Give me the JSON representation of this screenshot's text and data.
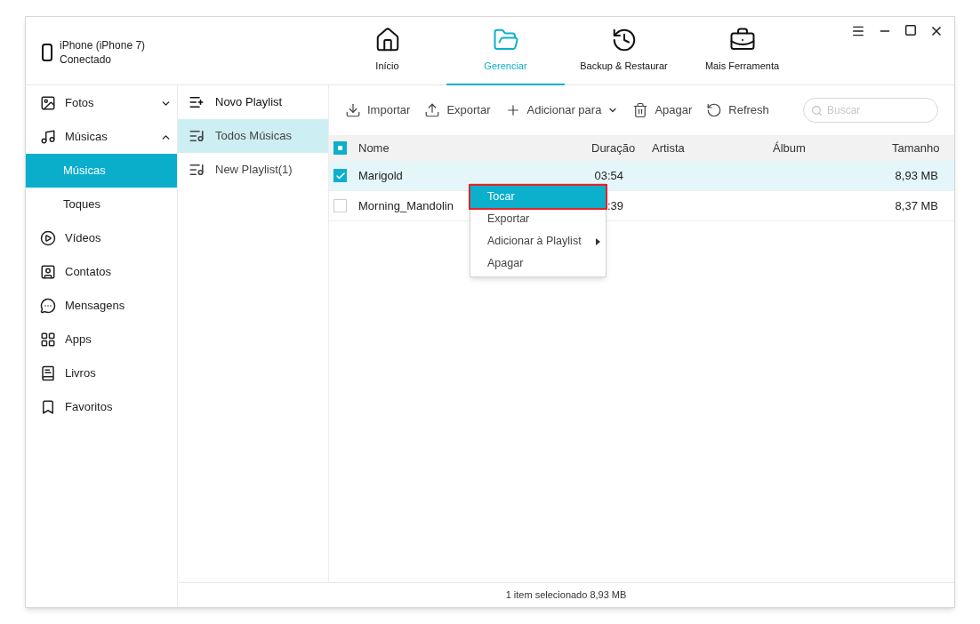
{
  "device": {
    "name": "iPhone (iPhone 7)",
    "status": "Conectado"
  },
  "nav": [
    {
      "label": "Início",
      "selected": false
    },
    {
      "label": "Gerenciar",
      "selected": true
    },
    {
      "label": "Backup & Restaurar",
      "selected": false
    },
    {
      "label": "Mais Ferramenta",
      "selected": false
    }
  ],
  "sidebar": {
    "items": [
      {
        "label": "Fotos",
        "expanded": false,
        "selected": false
      },
      {
        "label": "Músicas",
        "expanded": true,
        "selected": false,
        "children": [
          {
            "label": "Músicas",
            "selected": true
          },
          {
            "label": "Toques",
            "selected": false
          }
        ]
      },
      {
        "label": "Vídeos",
        "selected": false
      },
      {
        "label": "Contatos",
        "selected": false
      },
      {
        "label": "Mensagens",
        "selected": false
      },
      {
        "label": "Apps",
        "selected": false
      },
      {
        "label": "Livros",
        "selected": false
      },
      {
        "label": "Favoritos",
        "selected": false
      }
    ]
  },
  "playlists": [
    {
      "label": "Novo Playlist",
      "kind": "add",
      "selected": false
    },
    {
      "label": "Todos Músicas",
      "kind": "list",
      "selected": true
    },
    {
      "label": "New Playlist(1)",
      "kind": "list",
      "selected": false
    }
  ],
  "toolbar": [
    "Importar",
    "Exportar",
    "Adicionar para",
    "Apagar",
    "Refresh"
  ],
  "search": {
    "placeholder": "Buscar"
  },
  "table": {
    "select_all_indeterminate": true,
    "columns": [
      "Nome",
      "Duração",
      "Artista",
      "Álbum",
      "Tamanho"
    ],
    "rows": [
      {
        "name": "Marigold",
        "duration": "03:54",
        "size": "8,93 MB",
        "checked": true,
        "selected": true
      },
      {
        "name": "Morning_Mandolin",
        "duration": ":39",
        "size": "8,37 MB",
        "checked": false,
        "selected": false
      }
    ]
  },
  "context_menu": [
    {
      "label": "Tocar",
      "selected": true,
      "has_submenu": false
    },
    {
      "label": "Exportar",
      "selected": false,
      "has_submenu": false
    },
    {
      "label": "Adicionar à Playlist",
      "selected": false,
      "has_submenu": true
    },
    {
      "label": "Apagar",
      "selected": false,
      "has_submenu": false
    }
  ],
  "status_bar": "1 item selecionado 8,93 MB"
}
